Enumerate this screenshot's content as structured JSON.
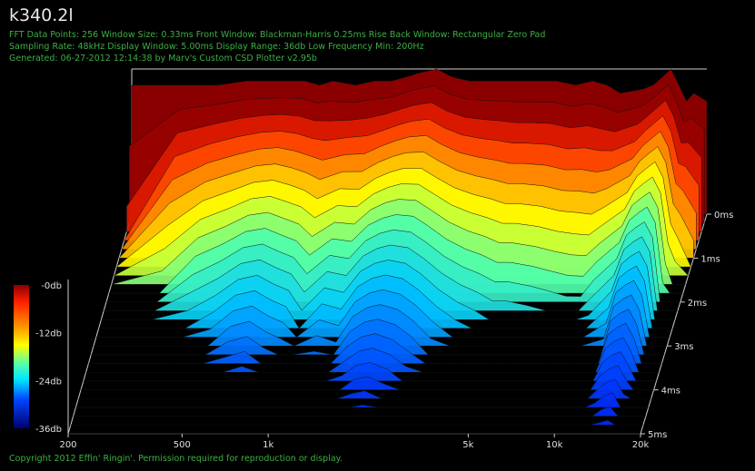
{
  "header": {
    "title": "k340.2l",
    "line1": "FFT Data Points: 256  Window Size: 0.33ms   Front Window: Blackman-Harris 0.25ms Rise   Back Window: Rectangular Zero Pad",
    "line2": "Sampling Rate: 48kHz  Display Window: 5.00ms   Display Range: 36db  Low Frequency Min: 200Hz",
    "line3": "Generated: 06-27-2012 12:14:38 by Marv's Custom CSD Plotter v2.95b"
  },
  "footer": {
    "copyright": "Copyright 2012 Effin' Ringin'. Permission required for reproduction or display."
  },
  "colors": {
    "text_green": "#3cb043",
    "background": "#000000",
    "axis": "#d0d0d0"
  },
  "chart_data": {
    "type": "waterfall",
    "title": "k340.2l",
    "x_axis": {
      "scale": "log",
      "range": [
        200,
        20000
      ],
      "ticks": [
        {
          "value": 200,
          "label": "200"
        },
        {
          "value": 500,
          "label": "500"
        },
        {
          "value": 1000,
          "label": "1k"
        },
        {
          "value": 5000,
          "label": "5k"
        },
        {
          "value": 10000,
          "label": "10k"
        },
        {
          "value": 20000,
          "label": "20k"
        }
      ]
    },
    "time_axis": {
      "range": [
        0,
        5
      ],
      "ticks": [
        {
          "value": 0,
          "label": "0ms"
        },
        {
          "value": 1,
          "label": "1ms"
        },
        {
          "value": 2,
          "label": "2ms"
        },
        {
          "value": 3,
          "label": "3ms"
        },
        {
          "value": 4,
          "label": "4ms"
        },
        {
          "value": 5,
          "label": "5ms"
        }
      ]
    },
    "level_scale": {
      "range": [
        -36,
        0
      ],
      "ticks": [
        {
          "value": 0,
          "label": "-0db"
        },
        {
          "value": -12,
          "label": "-12db"
        },
        {
          "value": -24,
          "label": "-24db"
        },
        {
          "value": -36,
          "label": "-36db"
        }
      ]
    },
    "front_slice": {
      "freqs": [
        200,
        300,
        400,
        500,
        600,
        700,
        800,
        900,
        1000,
        1200,
        1400,
        1600,
        1800,
        2000,
        2300,
        2600,
        3000,
        3500,
        4000,
        4500,
        5000,
        6000,
        7000,
        8000,
        9000,
        10000,
        12000,
        13000,
        14000,
        15000,
        16000,
        17000,
        18000,
        20000
      ],
      "levels": [
        -4,
        -4,
        -4,
        -3,
        -3,
        -3,
        -3,
        -4,
        -3,
        -4,
        -3,
        -3,
        -2,
        -1,
        0,
        -2,
        -3,
        -3,
        -3,
        -3,
        -3,
        -3,
        -4,
        -3,
        -4,
        -6,
        -5,
        -4,
        -2,
        0,
        -4,
        -8,
        -6,
        -8
      ]
    },
    "decay_ms": {
      "freqs": [
        200,
        300,
        400,
        500,
        600,
        700,
        800,
        900,
        1000,
        1200,
        1400,
        1600,
        1800,
        2000,
        2300,
        2600,
        3000,
        3500,
        4000,
        4500,
        5000,
        6000,
        7000,
        8000,
        9000,
        10000,
        12000,
        13000,
        14000,
        15000,
        16000,
        17000,
        18000,
        20000
      ],
      "values": [
        0.5,
        1.8,
        2.6,
        3.0,
        3.6,
        3.8,
        3.4,
        3.2,
        2.6,
        3.3,
        3.1,
        4.0,
        4.4,
        4.5,
        4.2,
        3.8,
        3.2,
        2.8,
        2.6,
        2.4,
        2.4,
        2.3,
        2.2,
        2.1,
        2.1,
        2.5,
        3.2,
        4.6,
        4.9,
        5.0,
        4.4,
        2.0,
        1.6,
        1.2
      ]
    }
  }
}
